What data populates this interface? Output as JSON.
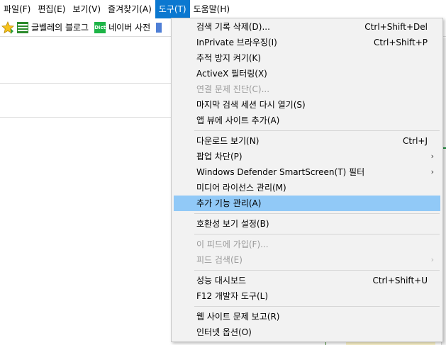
{
  "menubar": {
    "items": [
      {
        "label": "파일(F)"
      },
      {
        "label": "편집(E)"
      },
      {
        "label": "보기(V)"
      },
      {
        "label": "즐겨찾기(A)"
      },
      {
        "label": "도구(T)"
      },
      {
        "label": "도움말(H)"
      }
    ]
  },
  "favorites": {
    "items": [
      {
        "label": "글벨레의 블로그",
        "icon": "blog-icon"
      },
      {
        "label": "네이버 사전",
        "icon": "dict-icon",
        "icon_text": "Dict"
      }
    ]
  },
  "tools_menu": {
    "items": [
      {
        "label": "검색 기록 삭제(D)...",
        "shortcut": "Ctrl+Shift+Del"
      },
      {
        "label": "InPrivate 브라우징(I)",
        "shortcut": "Ctrl+Shift+P"
      },
      {
        "label": "추적 방지 켜기(K)"
      },
      {
        "label": "ActiveX 필터링(X)"
      },
      {
        "label": "연결 문제 진단(C)...",
        "state": "disabled"
      },
      {
        "label": "마지막 검색 세션 다시 열기(S)"
      },
      {
        "label": "앱 뷰에 사이트 추가(A)"
      },
      {
        "label": "다운로드 보기(N)",
        "shortcut": "Ctrl+J"
      },
      {
        "label": "팝업 차단(P)",
        "submenu_glyph": "›"
      },
      {
        "label": "Windows Defender SmartScreen(T) 필터",
        "submenu_glyph": "›"
      },
      {
        "label": "미디어 라이선스 관리(M)"
      },
      {
        "label": "추가 기능 관리(A)",
        "state": "highlighted"
      },
      {
        "label": "호환성 보기 설정(B)"
      },
      {
        "label": "이 피드에 가입(F)...",
        "state": "disabled"
      },
      {
        "label": "피드 검색(E)",
        "state": "disabled",
        "submenu_glyph": "›"
      },
      {
        "label": "성능 대시보드",
        "shortcut": "Ctrl+Shift+U"
      },
      {
        "label": "F12 개발자 도구(L)"
      },
      {
        "label": "웹 사이트 문제 보고(R)"
      },
      {
        "label": "인터넷 옵션(O)"
      }
    ]
  },
  "colors": {
    "active_menu": "#0b78d0",
    "highlight": "#91c9f7",
    "menu_bg": "#f2f2f2",
    "disabled_text": "#9a9a9a"
  }
}
